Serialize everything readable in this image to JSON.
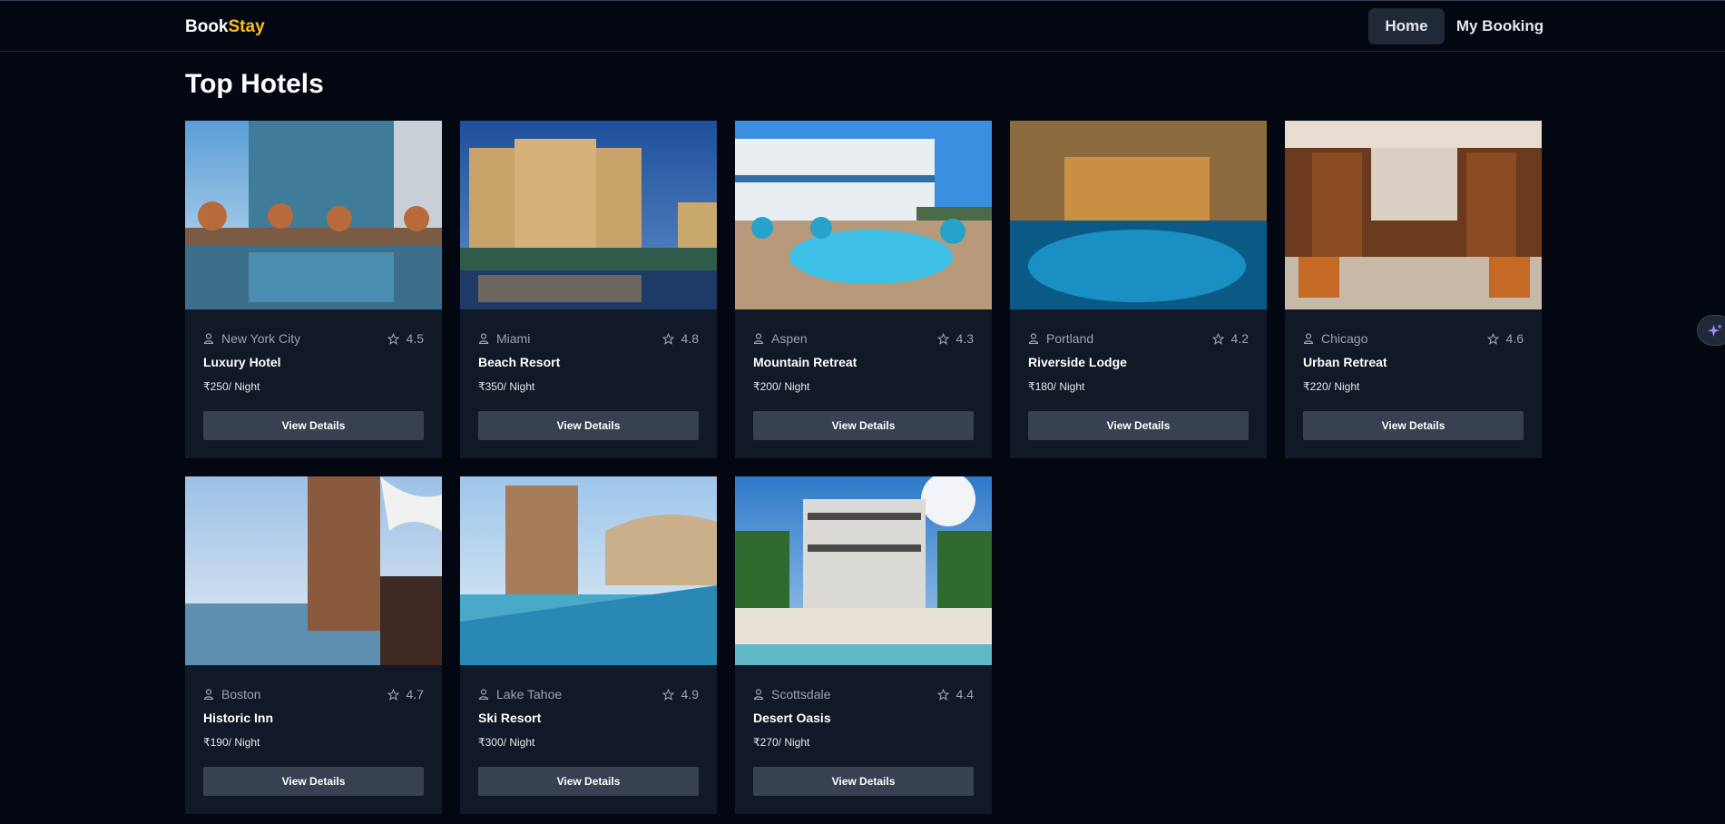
{
  "app": {
    "brand_part1": "Book",
    "brand_part2": "Stay"
  },
  "nav": {
    "home": "Home",
    "my_booking": "My Booking"
  },
  "page": {
    "title": "Top Hotels"
  },
  "hotels": [
    {
      "location": "New York City",
      "rating": "4.5",
      "name": "Luxury Hotel",
      "price": "₹250/ Night",
      "button": "View Details"
    },
    {
      "location": "Miami",
      "rating": "4.8",
      "name": "Beach Resort",
      "price": "₹350/ Night",
      "button": "View Details"
    },
    {
      "location": "Aspen",
      "rating": "4.3",
      "name": "Mountain Retreat",
      "price": "₹200/ Night",
      "button": "View Details"
    },
    {
      "location": "Portland",
      "rating": "4.2",
      "name": "Riverside Lodge",
      "price": "₹180/ Night",
      "button": "View Details"
    },
    {
      "location": "Chicago",
      "rating": "4.6",
      "name": "Urban Retreat",
      "price": "₹220/ Night",
      "button": "View Details"
    },
    {
      "location": "Boston",
      "rating": "4.7",
      "name": "Historic Inn",
      "price": "₹190/ Night",
      "button": "View Details"
    },
    {
      "location": "Lake Tahoe",
      "rating": "4.9",
      "name": "Ski Resort",
      "price": "₹300/ Night",
      "button": "View Details"
    },
    {
      "location": "Scottsdale",
      "rating": "4.4",
      "name": "Desert Oasis",
      "price": "₹270/ Night",
      "button": "View Details"
    }
  ],
  "colors": {
    "background": "#030712",
    "card": "#111827",
    "button": "#374151",
    "brand_accent": "#fbbf24"
  },
  "icons": {
    "location": "user-icon",
    "rating": "star-icon",
    "assistant": "sparkle-icon"
  }
}
